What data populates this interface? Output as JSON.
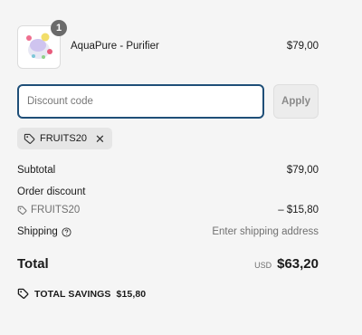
{
  "product": {
    "name": "AquaPure - Purifier",
    "price": "$79,00",
    "quantity": "1",
    "image_icon": "product-image"
  },
  "discount": {
    "placeholder": "Discount code",
    "value": "",
    "apply_label": "Apply"
  },
  "applied_code": {
    "code": "FRUITS20",
    "tag_icon": "tag-icon",
    "remove_icon": "close-icon"
  },
  "summary": {
    "subtotal_label": "Subtotal",
    "subtotal_value": "$79,00",
    "order_discount_label": "Order discount",
    "discount_code": "FRUITS20",
    "discount_value": "– $15,80",
    "shipping_label": "Shipping",
    "shipping_value": "Enter shipping address",
    "total_label": "Total",
    "currency": "USD",
    "total_value": "$63,20",
    "savings_label": "TOTAL SAVINGS",
    "savings_value": "$15,80"
  },
  "colors": {
    "input_focus_border": "#1f4f78",
    "background": "#f5f5f5",
    "badge": "#6b6b6b"
  }
}
